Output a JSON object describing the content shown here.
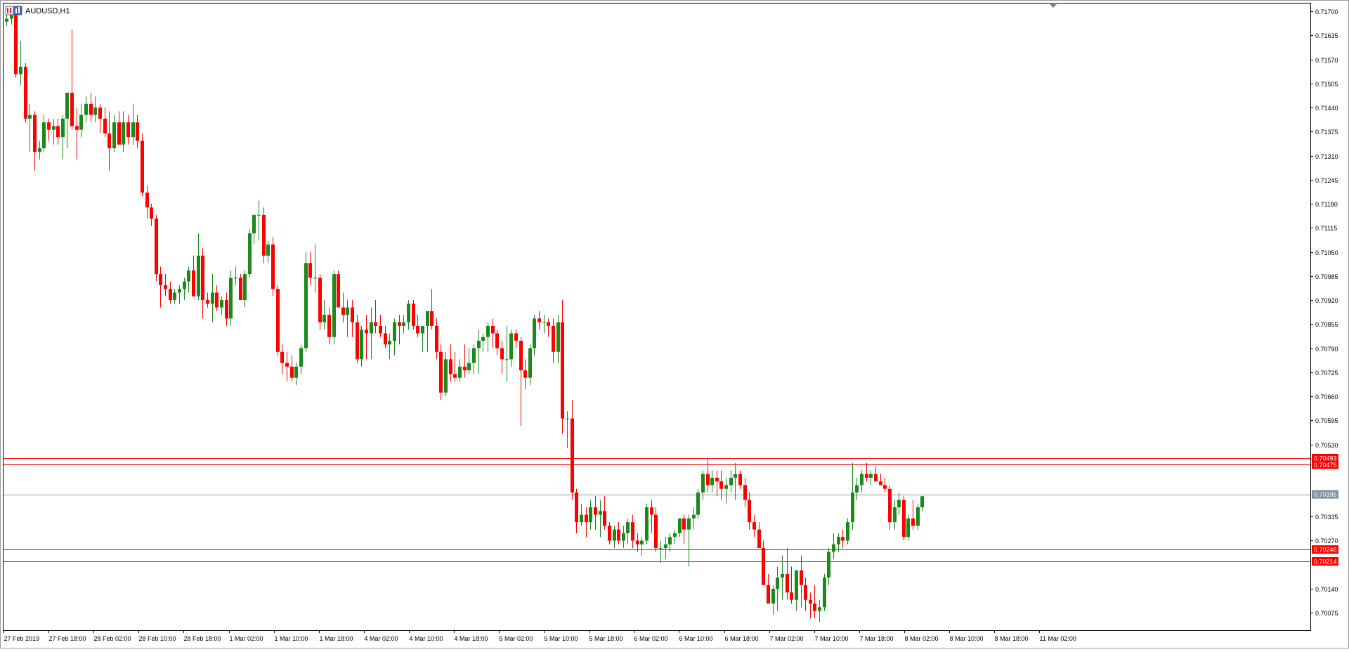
{
  "window": {
    "symbol_label": "AUDUSD,H1",
    "icon": "chart-window-icon"
  },
  "colors": {
    "bull": "#1b8a1b",
    "bear": "#ff0000",
    "wick_bull": "#1b8a1b",
    "wick_bear": "#ff0000",
    "level_line": "#ff0000",
    "bid_line": "#8095a8",
    "bid_tag_bg": "#7d90a4",
    "axis": "#000000"
  },
  "chart_data": {
    "type": "candlestick",
    "title": "AUDUSD,H1",
    "ylim": [
      0.70028,
      0.71721
    ],
    "yticks": [
      "0.71700",
      "0.71635",
      "0.71570",
      "0.71505",
      "0.71440",
      "0.71375",
      "0.71310",
      "0.71245",
      "0.71180",
      "0.71115",
      "0.71050",
      "0.70985",
      "0.70920",
      "0.70855",
      "0.70790",
      "0.70725",
      "0.70660",
      "0.70595",
      "0.70530",
      "0.70335",
      "0.70270",
      "0.70140",
      "0.70075"
    ],
    "xticks": [
      "27 Feb 2019",
      "27 Feb 18:00",
      "28 Feb 02:00",
      "28 Feb 10:00",
      "28 Feb 18:00",
      "1 Mar 02:00",
      "1 Mar 10:00",
      "1 Mar 18:00",
      "4 Mar 02:00",
      "4 Mar 10:00",
      "4 Mar 18:00",
      "5 Mar 02:00",
      "5 Mar 10:00",
      "5 Mar 18:00",
      "6 Mar 02:00",
      "6 Mar 10:00",
      "6 Mar 18:00",
      "7 Mar 02:00",
      "7 Mar 10:00",
      "7 Mar 18:00",
      "8 Mar 02:00",
      "8 Mar 10:00",
      "8 Mar 18:00",
      "11 Mar 02:00"
    ],
    "levels": [
      {
        "price": 0.70493,
        "label": "0.70493"
      },
      {
        "price": 0.70475,
        "label": "0.70475"
      },
      {
        "price": 0.70246,
        "label": "0.70246"
      },
      {
        "price": 0.70214,
        "label": "0.70214"
      }
    ],
    "bid": {
      "price": 0.70395,
      "label": "0.70395"
    },
    "candles": [
      [
        0.71672,
        0.7169,
        0.7166,
        0.7168
      ],
      [
        0.7168,
        0.717,
        0.71664,
        0.71692
      ],
      [
        0.71692,
        0.7171,
        0.7152,
        0.7153
      ],
      [
        0.7153,
        0.7162,
        0.715,
        0.7155
      ],
      [
        0.7155,
        0.7156,
        0.714,
        0.7141
      ],
      [
        0.7141,
        0.7145,
        0.7132,
        0.7142
      ],
      [
        0.7142,
        0.7143,
        0.7127,
        0.7132
      ],
      [
        0.7132,
        0.7135,
        0.713,
        0.7133
      ],
      [
        0.7133,
        0.7142,
        0.7132,
        0.714
      ],
      [
        0.714,
        0.7141,
        0.7135,
        0.7138
      ],
      [
        0.7138,
        0.7141,
        0.7134,
        0.7139
      ],
      [
        0.7139,
        0.7141,
        0.7134,
        0.7136
      ],
      [
        0.7136,
        0.7142,
        0.713,
        0.7141
      ],
      [
        0.7141,
        0.7146,
        0.7133,
        0.7148
      ],
      [
        0.7148,
        0.7165,
        0.7138,
        0.7139
      ],
      [
        0.7139,
        0.7144,
        0.713,
        0.7138
      ],
      [
        0.7138,
        0.7145,
        0.7136,
        0.7142
      ],
      [
        0.7142,
        0.7147,
        0.714,
        0.7145
      ],
      [
        0.7145,
        0.7148,
        0.714,
        0.7142
      ],
      [
        0.7142,
        0.7147,
        0.714,
        0.7144
      ],
      [
        0.7144,
        0.7145,
        0.7137,
        0.7141
      ],
      [
        0.7141,
        0.7144,
        0.7136,
        0.7137
      ],
      [
        0.7137,
        0.7143,
        0.7127,
        0.7133
      ],
      [
        0.7133,
        0.7142,
        0.7132,
        0.714
      ],
      [
        0.714,
        0.7143,
        0.7134,
        0.7134
      ],
      [
        0.7134,
        0.7143,
        0.7132,
        0.714
      ],
      [
        0.714,
        0.7142,
        0.7134,
        0.7136
      ],
      [
        0.7136,
        0.7145,
        0.7134,
        0.714
      ],
      [
        0.714,
        0.7142,
        0.7133,
        0.7135
      ],
      [
        0.7135,
        0.7137,
        0.712,
        0.7121
      ],
      [
        0.7121,
        0.7123,
        0.7114,
        0.7117
      ],
      [
        0.7117,
        0.7118,
        0.7112,
        0.7114
      ],
      [
        0.7114,
        0.7115,
        0.7097,
        0.7099
      ],
      [
        0.7099,
        0.7101,
        0.709,
        0.7096
      ],
      [
        0.7096,
        0.7099,
        0.7093,
        0.7095
      ],
      [
        0.7095,
        0.7097,
        0.7091,
        0.7092
      ],
      [
        0.7092,
        0.7095,
        0.7091,
        0.7094
      ],
      [
        0.7094,
        0.7096,
        0.7091,
        0.7095
      ],
      [
        0.7095,
        0.7098,
        0.7092,
        0.7097
      ],
      [
        0.7097,
        0.7101,
        0.7094,
        0.71
      ],
      [
        0.71,
        0.7104,
        0.7093,
        0.7093
      ],
      [
        0.7093,
        0.711,
        0.7092,
        0.7104
      ],
      [
        0.7104,
        0.7106,
        0.7087,
        0.7092
      ],
      [
        0.7092,
        0.7094,
        0.709,
        0.7091
      ],
      [
        0.7091,
        0.7099,
        0.7086,
        0.7094
      ],
      [
        0.7094,
        0.7096,
        0.7089,
        0.709
      ],
      [
        0.709,
        0.7093,
        0.7088,
        0.7092
      ],
      [
        0.7092,
        0.7094,
        0.7085,
        0.7087
      ],
      [
        0.7087,
        0.71,
        0.7085,
        0.7098
      ],
      [
        0.7098,
        0.7101,
        0.7096,
        0.7098
      ],
      [
        0.7098,
        0.7099,
        0.7092,
        0.7092
      ],
      [
        0.7092,
        0.71,
        0.709,
        0.7099
      ],
      [
        0.7099,
        0.7111,
        0.7098,
        0.711
      ],
      [
        0.711,
        0.7113,
        0.7107,
        0.7115
      ],
      [
        0.7115,
        0.7119,
        0.7108,
        0.7115
      ],
      [
        0.7115,
        0.7117,
        0.7102,
        0.7104
      ],
      [
        0.7104,
        0.7108,
        0.7102,
        0.7107
      ],
      [
        0.7107,
        0.7109,
        0.7093,
        0.7095
      ],
      [
        0.7095,
        0.7096,
        0.7077,
        0.7078
      ],
      [
        0.7078,
        0.708,
        0.7072,
        0.7075
      ],
      [
        0.7075,
        0.7078,
        0.707,
        0.7074
      ],
      [
        0.7074,
        0.7077,
        0.707,
        0.7071
      ],
      [
        0.7071,
        0.7075,
        0.7069,
        0.7074
      ],
      [
        0.7074,
        0.708,
        0.7072,
        0.7079
      ],
      [
        0.7079,
        0.7105,
        0.7078,
        0.7102
      ],
      [
        0.7102,
        0.7105,
        0.7096,
        0.7098
      ],
      [
        0.7098,
        0.7107,
        0.7094,
        0.7098
      ],
      [
        0.7098,
        0.7099,
        0.7084,
        0.7086
      ],
      [
        0.7086,
        0.7092,
        0.7084,
        0.7088
      ],
      [
        0.7088,
        0.709,
        0.708,
        0.7082
      ],
      [
        0.7082,
        0.71,
        0.708,
        0.7099
      ],
      [
        0.7099,
        0.71,
        0.7093,
        0.709
      ],
      [
        0.709,
        0.7094,
        0.7086,
        0.7088
      ],
      [
        0.7088,
        0.7092,
        0.7082,
        0.709
      ],
      [
        0.709,
        0.7092,
        0.7082,
        0.7086
      ],
      [
        0.7086,
        0.7088,
        0.7075,
        0.7076
      ],
      [
        0.7076,
        0.7085,
        0.7074,
        0.7084
      ],
      [
        0.7084,
        0.7088,
        0.7076,
        0.7083
      ],
      [
        0.7083,
        0.709,
        0.7076,
        0.7086
      ],
      [
        0.7086,
        0.7092,
        0.7083,
        0.7085
      ],
      [
        0.7085,
        0.7088,
        0.7082,
        0.7083
      ],
      [
        0.7083,
        0.7085,
        0.7079,
        0.708
      ],
      [
        0.708,
        0.7083,
        0.7076,
        0.7081
      ],
      [
        0.7081,
        0.7087,
        0.7077,
        0.7086
      ],
      [
        0.7086,
        0.7088,
        0.708,
        0.7085
      ],
      [
        0.7085,
        0.7088,
        0.7083,
        0.7086
      ],
      [
        0.7086,
        0.7092,
        0.7084,
        0.7091
      ],
      [
        0.7091,
        0.7092,
        0.7084,
        0.7085
      ],
      [
        0.7085,
        0.7088,
        0.7082,
        0.7083
      ],
      [
        0.7083,
        0.7084,
        0.7078,
        0.7085
      ],
      [
        0.7085,
        0.7088,
        0.7078,
        0.7089
      ],
      [
        0.7089,
        0.7095,
        0.7084,
        0.7085
      ],
      [
        0.7085,
        0.7087,
        0.7076,
        0.7078
      ],
      [
        0.7078,
        0.708,
        0.7065,
        0.7067
      ],
      [
        0.7067,
        0.7078,
        0.7066,
        0.7076
      ],
      [
        0.7076,
        0.708,
        0.707,
        0.7072
      ],
      [
        0.7072,
        0.7078,
        0.707,
        0.7071
      ],
      [
        0.7071,
        0.7076,
        0.707,
        0.7074
      ],
      [
        0.7074,
        0.708,
        0.7071,
        0.7073
      ],
      [
        0.7073,
        0.7079,
        0.7072,
        0.7075
      ],
      [
        0.7075,
        0.708,
        0.7072,
        0.7079
      ],
      [
        0.7079,
        0.7084,
        0.7072,
        0.7081
      ],
      [
        0.7081,
        0.7083,
        0.7078,
        0.7082
      ],
      [
        0.7082,
        0.7086,
        0.7078,
        0.7085
      ],
      [
        0.7085,
        0.7087,
        0.7079,
        0.7083
      ],
      [
        0.7083,
        0.7084,
        0.7077,
        0.7079
      ],
      [
        0.7079,
        0.7081,
        0.7072,
        0.7076
      ],
      [
        0.7076,
        0.7085,
        0.707,
        0.7076
      ],
      [
        0.7076,
        0.7084,
        0.7074,
        0.7083
      ],
      [
        0.7083,
        0.7084,
        0.7079,
        0.7081
      ],
      [
        0.7081,
        0.7082,
        0.7058,
        0.7073
      ],
      [
        0.7073,
        0.7076,
        0.7068,
        0.7071
      ],
      [
        0.7071,
        0.708,
        0.7069,
        0.7079
      ],
      [
        0.7079,
        0.7088,
        0.7077,
        0.7087
      ],
      [
        0.7087,
        0.7089,
        0.7084,
        0.7086
      ],
      [
        0.7086,
        0.7088,
        0.7083,
        0.7086
      ],
      [
        0.7086,
        0.7087,
        0.7082,
        0.7085
      ],
      [
        0.7085,
        0.7087,
        0.7075,
        0.7078
      ],
      [
        0.7078,
        0.7088,
        0.7075,
        0.7086
      ],
      [
        0.7086,
        0.7092,
        0.7056,
        0.706
      ],
      [
        0.706,
        0.7062,
        0.7052,
        0.706
      ],
      [
        0.706,
        0.7065,
        0.7038,
        0.704
      ],
      [
        0.704,
        0.7041,
        0.7029,
        0.7032
      ],
      [
        0.7032,
        0.7037,
        0.7031,
        0.7034
      ],
      [
        0.7034,
        0.7036,
        0.7028,
        0.7032
      ],
      [
        0.7032,
        0.7038,
        0.703,
        0.7036
      ],
      [
        0.7036,
        0.7039,
        0.703,
        0.7034
      ],
      [
        0.7034,
        0.7038,
        0.7028,
        0.7035
      ],
      [
        0.7035,
        0.7039,
        0.703,
        0.7031
      ],
      [
        0.7031,
        0.7032,
        0.7026,
        0.7027
      ],
      [
        0.7027,
        0.7031,
        0.7025,
        0.703
      ],
      [
        0.703,
        0.7032,
        0.7026,
        0.7027
      ],
      [
        0.7027,
        0.7031,
        0.7025,
        0.7029
      ],
      [
        0.7029,
        0.7033,
        0.7026,
        0.7032
      ],
      [
        0.7032,
        0.7034,
        0.7025,
        0.7027
      ],
      [
        0.7027,
        0.7029,
        0.7024,
        0.7026
      ],
      [
        0.7026,
        0.7028,
        0.7023,
        0.7027
      ],
      [
        0.7027,
        0.7037,
        0.7026,
        0.7036
      ],
      [
        0.7036,
        0.7038,
        0.7029,
        0.7034
      ],
      [
        0.7034,
        0.7036,
        0.7024,
        0.7025
      ],
      [
        0.7025,
        0.7027,
        0.7021,
        0.7025
      ],
      [
        0.7025,
        0.7028,
        0.7022,
        0.7026
      ],
      [
        0.7026,
        0.7029,
        0.7024,
        0.7028
      ],
      [
        0.7028,
        0.703,
        0.7026,
        0.7029
      ],
      [
        0.7029,
        0.7033,
        0.7028,
        0.7033
      ],
      [
        0.7033,
        0.7034,
        0.7026,
        0.703
      ],
      [
        0.703,
        0.7034,
        0.702,
        0.7033
      ],
      [
        0.7033,
        0.7036,
        0.703,
        0.7034
      ],
      [
        0.7034,
        0.7041,
        0.7033,
        0.704
      ],
      [
        0.704,
        0.7046,
        0.7038,
        0.7045
      ],
      [
        0.7045,
        0.7049,
        0.704,
        0.7042
      ],
      [
        0.7042,
        0.7046,
        0.704,
        0.7044
      ],
      [
        0.7044,
        0.7046,
        0.7039,
        0.7043
      ],
      [
        0.7043,
        0.7046,
        0.7038,
        0.7041
      ],
      [
        0.7041,
        0.7044,
        0.7037,
        0.7042
      ],
      [
        0.7042,
        0.7046,
        0.704,
        0.7044
      ],
      [
        0.7044,
        0.7048,
        0.7038,
        0.7045
      ],
      [
        0.7045,
        0.7046,
        0.7041,
        0.7042
      ],
      [
        0.7042,
        0.7044,
        0.7036,
        0.7038
      ],
      [
        0.7038,
        0.704,
        0.703,
        0.7032
      ],
      [
        0.7032,
        0.7034,
        0.7028,
        0.703
      ],
      [
        0.703,
        0.7032,
        0.7025,
        0.7025
      ],
      [
        0.7025,
        0.7027,
        0.7017,
        0.7015
      ],
      [
        0.7015,
        0.7018,
        0.701,
        0.701
      ],
      [
        0.701,
        0.7015,
        0.7007,
        0.7014
      ],
      [
        0.7014,
        0.702,
        0.7008,
        0.7017
      ],
      [
        0.7017,
        0.7023,
        0.7011,
        0.7018
      ],
      [
        0.7018,
        0.7025,
        0.7011,
        0.7013
      ],
      [
        0.7013,
        0.702,
        0.701,
        0.7011
      ],
      [
        0.7011,
        0.7019,
        0.7008,
        0.7019
      ],
      [
        0.7019,
        0.7023,
        0.7009,
        0.7015
      ],
      [
        0.7015,
        0.7017,
        0.7008,
        0.7011
      ],
      [
        0.7011,
        0.7013,
        0.7006,
        0.701
      ],
      [
        0.701,
        0.7015,
        0.7006,
        0.7008
      ],
      [
        0.7008,
        0.7011,
        0.7005,
        0.7009
      ],
      [
        0.7009,
        0.7018,
        0.7008,
        0.7017
      ],
      [
        0.7017,
        0.7025,
        0.7015,
        0.7024
      ],
      [
        0.7024,
        0.7029,
        0.7022,
        0.7026
      ],
      [
        0.7026,
        0.7029,
        0.7024,
        0.7028
      ],
      [
        0.7028,
        0.703,
        0.7025,
        0.7027
      ],
      [
        0.7027,
        0.7033,
        0.7026,
        0.7032
      ],
      [
        0.7032,
        0.7048,
        0.703,
        0.704
      ],
      [
        0.704,
        0.7044,
        0.7038,
        0.7042
      ],
      [
        0.7042,
        0.7046,
        0.704,
        0.7045
      ],
      [
        0.7045,
        0.7048,
        0.7043,
        0.7044
      ],
      [
        0.7044,
        0.7046,
        0.7042,
        0.7045
      ],
      [
        0.7045,
        0.7047,
        0.7043,
        0.7043
      ],
      [
        0.7043,
        0.7045,
        0.7042,
        0.7042
      ],
      [
        0.7042,
        0.7044,
        0.704,
        0.7041
      ],
      [
        0.7041,
        0.7042,
        0.703,
        0.7032
      ],
      [
        0.7032,
        0.7038,
        0.703,
        0.7036
      ],
      [
        0.7036,
        0.704,
        0.7034,
        0.7038
      ],
      [
        0.7038,
        0.7039,
        0.7027,
        0.7028
      ],
      [
        0.7028,
        0.7034,
        0.7027,
        0.7033
      ],
      [
        0.7033,
        0.7038,
        0.703,
        0.7031
      ],
      [
        0.7031,
        0.7037,
        0.703,
        0.7036
      ],
      [
        0.7036,
        0.7039,
        0.7035,
        0.7039
      ]
    ]
  }
}
